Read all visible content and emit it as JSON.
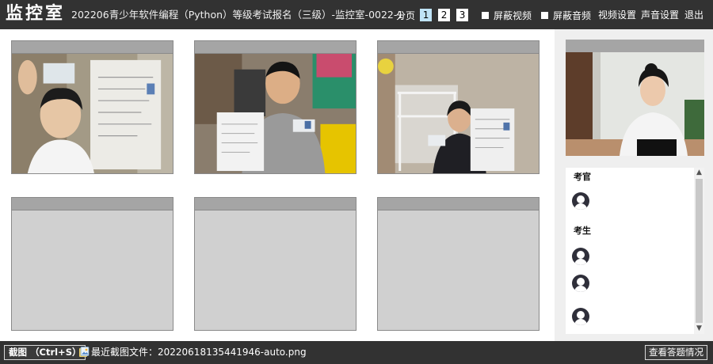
{
  "app": {
    "title": "监控室",
    "room_title": "202206青少年软件编程（Python）等级考试报名（三级）-监控室-0022-1"
  },
  "pager": {
    "label": "分页",
    "pages": [
      "1",
      "2",
      "3"
    ],
    "current": "1"
  },
  "toolbar": {
    "mute_video": "屏蔽视频",
    "mute_audio": "屏蔽音频",
    "video_settings": "视频设置",
    "audio_settings": "声音设置",
    "exit": "退出"
  },
  "roster": {
    "examiner_title": "考官",
    "candidate_title": "考生",
    "examiner_count": 1,
    "candidate_count": 3
  },
  "bottom": {
    "screenshot_button": "截图 （Ctrl+S）",
    "recent_file": "最近截图文件：20220618135441946-auto.png",
    "view_answers": "查看答题情况"
  },
  "colors": {
    "topbar": "#323232",
    "tile_head": "#a5a5a5",
    "tile_body": "#d0d0d0",
    "active_page": "#bfe3f7"
  },
  "icons": {
    "file": "file-image-icon",
    "avatar": "user-avatar-icon",
    "scroll_up": "chevron-up-icon",
    "scroll_down": "chevron-down-icon"
  }
}
